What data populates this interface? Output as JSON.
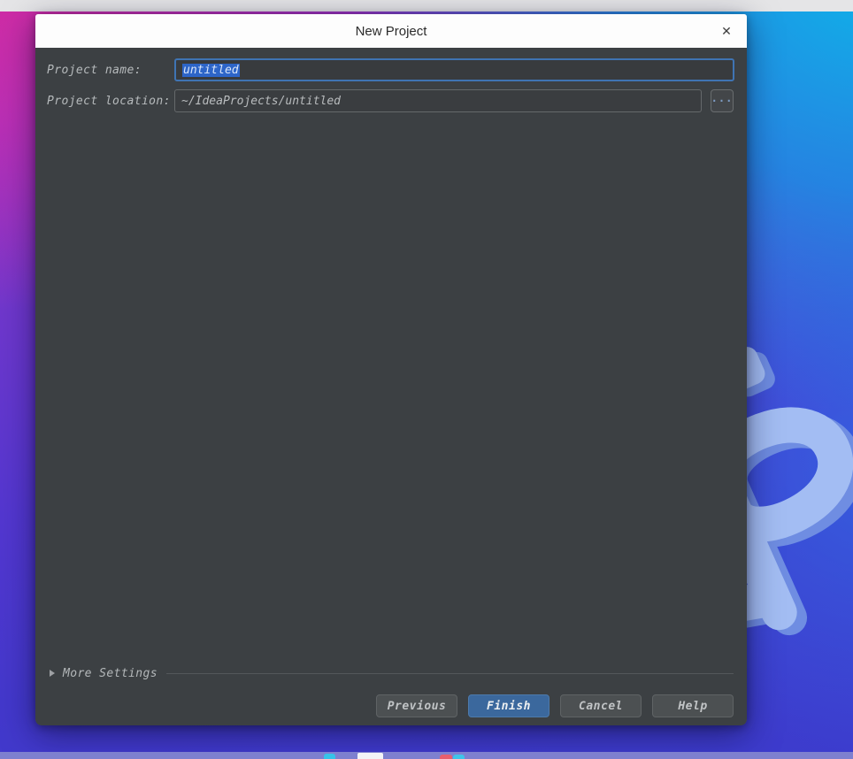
{
  "window": {
    "title": "New Project",
    "close_glyph": "✕"
  },
  "form": {
    "name_label": "Project name:",
    "name_value": "untitled",
    "location_label": "Project location:",
    "location_value": "~/IdeaProjects/untitled",
    "browse_label": "..."
  },
  "more_settings": {
    "label": "More Settings"
  },
  "buttons": {
    "previous": "Previous",
    "finish": "Finish",
    "cancel": "Cancel",
    "help": "Help"
  },
  "colors": {
    "dialog_body_bg": "#3c4043",
    "titlebar_bg": "#fdfdfd",
    "focus_border_blue": "#3f74b3",
    "text_selection_blue": "#2d65c8",
    "primary_button_blue": "#3b689d",
    "button_gray": "#4c5052",
    "top_strip_gray": "#e5e5e7",
    "taskbar_lavender": "#7e80cf",
    "wallpaper_pink": "#d42ba0",
    "wallpaper_cyan": "#0ab8ea",
    "wallpaper_blue_violet": "#3c3ccd"
  },
  "taskbar": {
    "icons": [
      {
        "name": "cyan-dock-icon"
      },
      {
        "name": "white-window-dock-icon"
      },
      {
        "name": "red-dock-icon"
      },
      {
        "name": "cyan-dock-icon-2"
      }
    ]
  }
}
